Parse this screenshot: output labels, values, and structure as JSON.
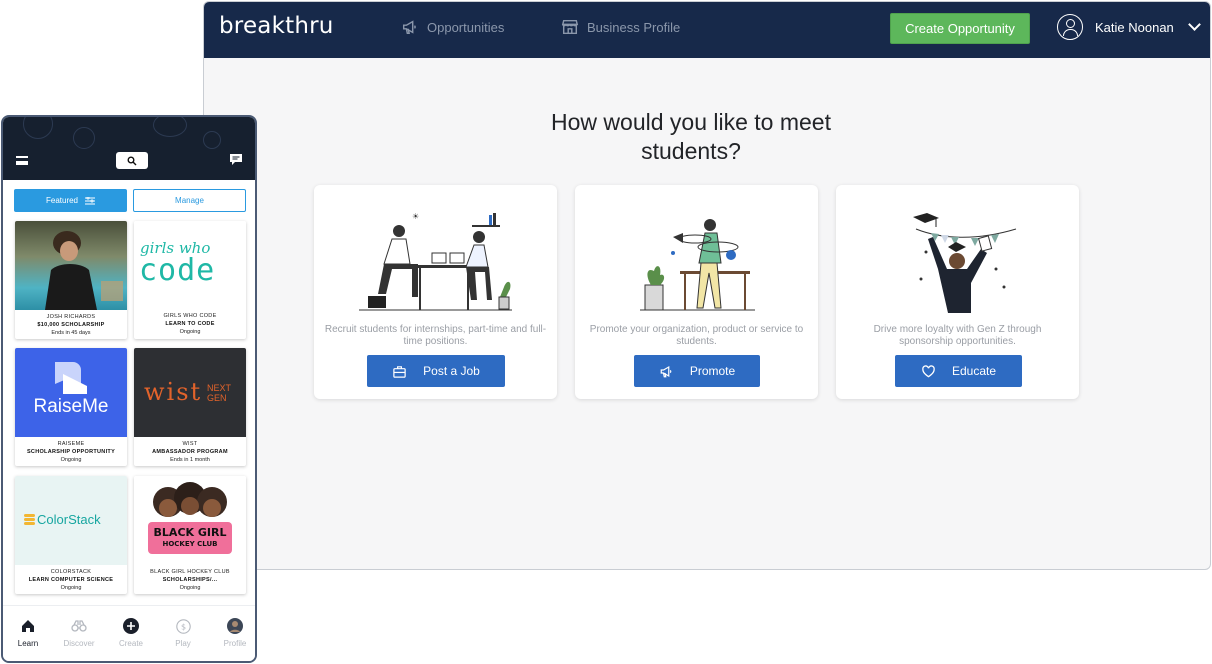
{
  "desktop": {
    "logo": "breakthru",
    "nav": [
      {
        "label": "Opportunities",
        "icon": "megaphone-icon"
      },
      {
        "label": "Business Profile",
        "icon": "storefront-icon"
      }
    ],
    "create_button": "Create Opportunity",
    "user_name": "Katie Noonan",
    "heading": "How would you like to meet students?",
    "cards": [
      {
        "description": "Recruit students for internships, part-time and full-time positions.",
        "button": "Post a Job",
        "button_icon": "briefcase-icon"
      },
      {
        "description": "Promote your organization, product or service to students.",
        "button": "Promote",
        "button_icon": "megaphone-icon"
      },
      {
        "description": "Drive more loyalty with Gen Z through sponsorship opportunities.",
        "button": "Educate",
        "button_icon": "heart-icon"
      }
    ],
    "colors": {
      "nav_bg": "#17294a",
      "create_green": "#5db75b",
      "button_blue": "#2e6bc2"
    }
  },
  "phone": {
    "segments": {
      "featured": "Featured",
      "manage": "Manage"
    },
    "tiles": [
      {
        "org": "JOSH RICHARDS",
        "title": "$10,000 SCHOLARSHIP",
        "status": "Ends in 45 days"
      },
      {
        "org": "GIRLS WHO CODE",
        "title": "LEARN TO CODE",
        "status": "Ongoing",
        "logo_top": "girls who",
        "logo_bottom": "code"
      },
      {
        "org": "RAISEME",
        "title": "SCHOLARSHIP OPPORTUNITY",
        "status": "Ongoing",
        "logo": "RaiseMe"
      },
      {
        "org": "WIST",
        "title": "AMBASSADOR PROGRAM",
        "status": "Ends in 1 month",
        "logo": "wist",
        "logo_sub1": "NEXT",
        "logo_sub2": "GEN"
      },
      {
        "org": "COLORSTACK",
        "title": "LEARN COMPUTER SCIENCE",
        "status": "Ongoing",
        "logo": "ColorStack"
      },
      {
        "org": "BLACK GIRL HOCKEY CLUB",
        "title": "SCHOLARSHIPS/...",
        "status": "Ongoing",
        "logo_top": "BLACK GIRL",
        "logo_bottom": "HOCKEY CLUB"
      }
    ],
    "tabs": [
      {
        "label": "Learn",
        "icon": "home-icon"
      },
      {
        "label": "Discover",
        "icon": "binoculars-icon"
      },
      {
        "label": "Create",
        "icon": "plus-circle-icon"
      },
      {
        "label": "Play",
        "icon": "dollar-coin-icon"
      },
      {
        "label": "Profile",
        "icon": "avatar-icon"
      }
    ]
  }
}
